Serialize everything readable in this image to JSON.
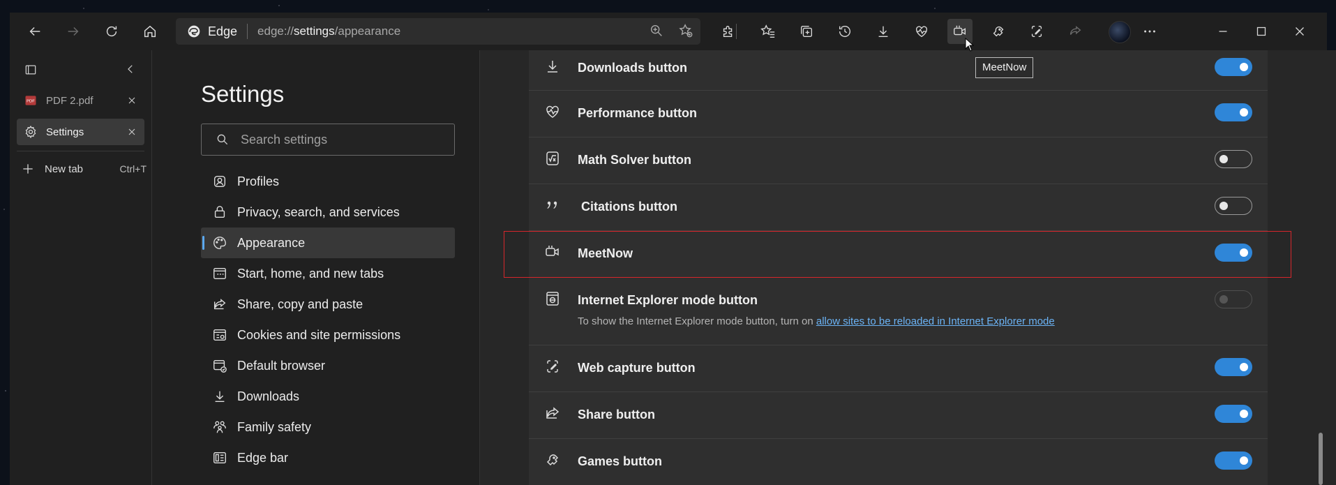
{
  "toolbar": {
    "address": {
      "brand": "Edge",
      "url_prefix": "edge://",
      "url_bold": "settings",
      "url_suffix": "/appearance"
    },
    "tooltip": "MeetNow",
    "icons": [
      "back-icon",
      "forward-icon",
      "refresh-icon",
      "home-icon",
      "zoom-icon",
      "add-favorite-icon",
      "extensions-icon",
      "favorites-icon",
      "collections-icon",
      "history-icon",
      "downloads-icon",
      "performance-icon",
      "meetnow-icon",
      "games-icon",
      "web-capture-icon",
      "share-icon",
      "more-icon"
    ]
  },
  "window": {
    "minimize_icon": "minimize-icon",
    "maximize_icon": "maximize-icon",
    "close_icon": "close-icon"
  },
  "tabs": {
    "items": [
      {
        "label": "PDF 2.pdf",
        "icon": "pdf-icon",
        "active": false
      },
      {
        "label": "Settings",
        "icon": "gear-icon",
        "active": true
      }
    ],
    "new_tab_label": "New tab",
    "new_tab_shortcut": "Ctrl+T"
  },
  "settings_nav": {
    "title": "Settings",
    "search_placeholder": "Search settings",
    "items": [
      {
        "label": "Profiles",
        "icon": "profile-icon"
      },
      {
        "label": "Privacy, search, and services",
        "icon": "lock-icon"
      },
      {
        "label": "Appearance",
        "icon": "palette-icon",
        "active": true
      },
      {
        "label": "Start, home, and new tabs",
        "icon": "start-page-icon"
      },
      {
        "label": "Share, copy and paste",
        "icon": "share-icon"
      },
      {
        "label": "Cookies and site permissions",
        "icon": "cookies-icon"
      },
      {
        "label": "Default browser",
        "icon": "default-browser-icon"
      },
      {
        "label": "Downloads",
        "icon": "downloads-icon"
      },
      {
        "label": "Family safety",
        "icon": "family-icon"
      },
      {
        "label": "Edge bar",
        "icon": "edge-bar-icon"
      }
    ]
  },
  "content": {
    "rows": [
      {
        "label": "Downloads button",
        "icon": "downloads-icon",
        "state": "on"
      },
      {
        "label": "Performance button",
        "icon": "performance-icon",
        "state": "on"
      },
      {
        "label": "Math Solver button",
        "icon": "math-solver-icon",
        "state": "off"
      },
      {
        "label": "Citations button",
        "icon": "citations-icon",
        "state": "off"
      },
      {
        "label": "MeetNow",
        "icon": "meetnow-icon",
        "state": "on",
        "highlighted": true
      },
      {
        "label": "Internet Explorer mode button",
        "icon": "ie-mode-icon",
        "state": "disabled",
        "sub_text": "To show the Internet Explorer mode button, turn on ",
        "sub_link": "allow sites to be reloaded in Internet Explorer mode"
      },
      {
        "label": "Web capture button",
        "icon": "web-capture-icon",
        "state": "on"
      },
      {
        "label": "Share button",
        "icon": "share-icon",
        "state": "on"
      },
      {
        "label": "Games button",
        "icon": "games-icon",
        "state": "on"
      }
    ]
  },
  "colors": {
    "accent": "#2f86d8",
    "link": "#6bb3f5",
    "highlight_border": "#d7262b"
  }
}
